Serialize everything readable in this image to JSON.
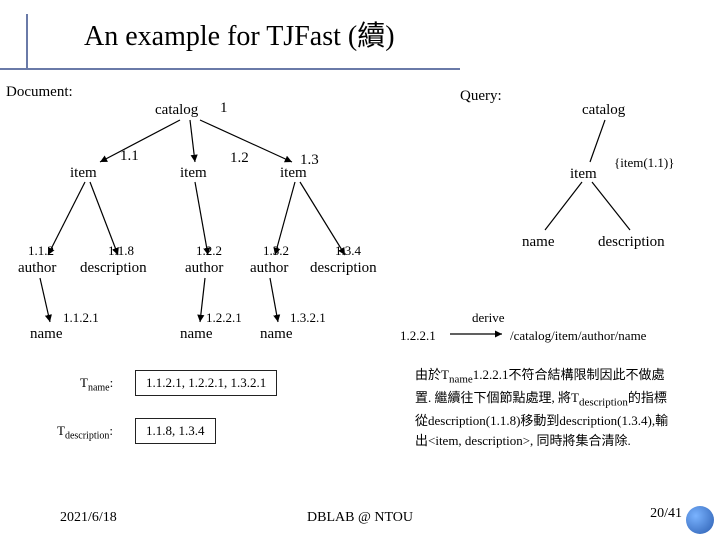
{
  "title": "An example for TJFast (續)",
  "labels": {
    "document": "Document:",
    "query": "Query:"
  },
  "doc_tree": {
    "root": {
      "name": "catalog",
      "id": "1"
    },
    "items": [
      {
        "name": "item",
        "id": "1.1"
      },
      {
        "name": "item",
        "id": "1.2"
      },
      {
        "name": "item",
        "id": "1.3"
      }
    ],
    "level3": [
      {
        "name": "author",
        "id": "1.1.2"
      },
      {
        "name": "description",
        "id": "1.1.8"
      },
      {
        "name": "author",
        "id": "1.2.2"
      },
      {
        "name": "author",
        "id": "1.3.2"
      },
      {
        "name": "description",
        "id": "1.3.4"
      }
    ],
    "level4": [
      {
        "name": "name",
        "id": "1.1.2.1"
      },
      {
        "name": "name",
        "id": "1.2.2.1"
      },
      {
        "name": "name",
        "id": "1.3.2.1"
      }
    ]
  },
  "query_tree": {
    "root": "catalog",
    "item": {
      "name": "item",
      "ann": "{item(1.1)}"
    },
    "leaves": [
      "name",
      "description"
    ]
  },
  "T": {
    "name_label": "T",
    "name_sub": "name",
    "name_vals": "1.1.2.1,  1.2.2.1, 1.3.2.1",
    "desc_label": "T",
    "desc_sub": "description",
    "desc_vals": "1.1.8,  1.3.4"
  },
  "derive": {
    "label": "derive",
    "val": "1.2.2.1",
    "path": "/catalog/item/author/name"
  },
  "explain": "由於Tname1.2.2.1不符合結構限制因此不做處置. 繼續往下個節點處理, 將Tdescription的指標從description(1.1.8)移動到description(1.3.4),輸出<item, description>, 同時將集合清除.",
  "footer": {
    "date": "2021/6/18",
    "org": "DBLAB @ NTOU",
    "page": "20/41"
  }
}
